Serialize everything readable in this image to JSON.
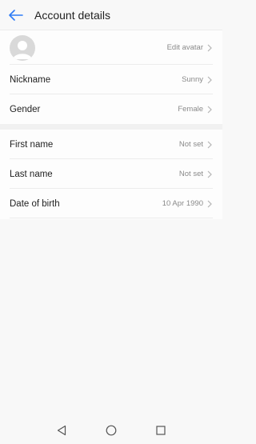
{
  "header": {
    "title": "Account details",
    "back_icon": "arrow-left-icon",
    "accent": "#2f7cf6"
  },
  "profile": {
    "avatar_icon": "user-avatar-icon",
    "edit_avatar": "Edit avatar",
    "nickname_label": "Nickname",
    "nickname_value": "Sunny",
    "gender_label": "Gender",
    "gender_value": "Female"
  },
  "personal": {
    "first_name_label": "First name",
    "first_name_value": "Not set",
    "last_name_label": "Last name",
    "last_name_value": "Not set",
    "dob_label": "Date of birth",
    "dob_value": "10 Apr 1990"
  },
  "navbar": {
    "back": "triangle-back-icon",
    "home": "circle-home-icon",
    "recents": "square-recents-icon"
  }
}
